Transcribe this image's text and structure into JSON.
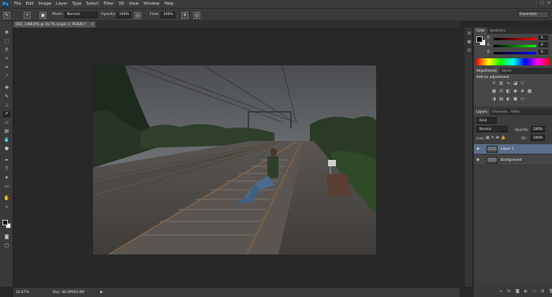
{
  "app": {
    "logo": "Ps"
  },
  "menu": [
    "File",
    "Edit",
    "Image",
    "Layer",
    "Type",
    "Select",
    "Filter",
    "3D",
    "View",
    "Window",
    "Help"
  ],
  "window_controls": [
    "–",
    "□",
    "×"
  ],
  "options_bar": {
    "mode_label": "Mode:",
    "mode_value": "Normal",
    "opacity_label": "Opacity:",
    "opacity_value": "100%",
    "flow_label": "Flow:",
    "flow_value": "100%",
    "workspace": "Essentials"
  },
  "document_tab": {
    "title": "DSC_1486.JPG @ 16.7% (Layer 1, RGB/8) *",
    "close": "×"
  },
  "status_bar": {
    "zoom": "16.67%",
    "doc_info": "Doc: 46.0M/92.0M",
    "arrow": "▶"
  },
  "color_panel": {
    "tabs": [
      "Color",
      "Swatches"
    ],
    "sliders": [
      {
        "label": "R",
        "value": "0"
      },
      {
        "label": "G",
        "value": "0"
      },
      {
        "label": "B",
        "value": "0"
      }
    ],
    "foreground": "#000000",
    "background": "#ffffff"
  },
  "adjustments_panel": {
    "tabs": [
      "Adjustments",
      "Styles"
    ],
    "heading": "Add an adjustment"
  },
  "layers_panel": {
    "tabs": [
      "Layers",
      "Channels",
      "Paths"
    ],
    "filter_value": "Kind",
    "blend_mode": "Normal",
    "opacity_label": "Opacity:",
    "opacity_value": "100%",
    "lock_label": "Lock:",
    "fill_label": "Fill:",
    "fill_value": "100%",
    "layers": [
      {
        "name": "Layer 1",
        "selected": true
      },
      {
        "name": "Background",
        "selected": false
      }
    ],
    "footer_icons": [
      "link-icon",
      "fx-icon",
      "mask-icon",
      "adjustment-icon",
      "folder-icon",
      "new-layer-icon",
      "trash-icon"
    ]
  },
  "colors": {
    "accent_selected": "#5b6e8c",
    "menu_bg": "#3c3c3c"
  }
}
